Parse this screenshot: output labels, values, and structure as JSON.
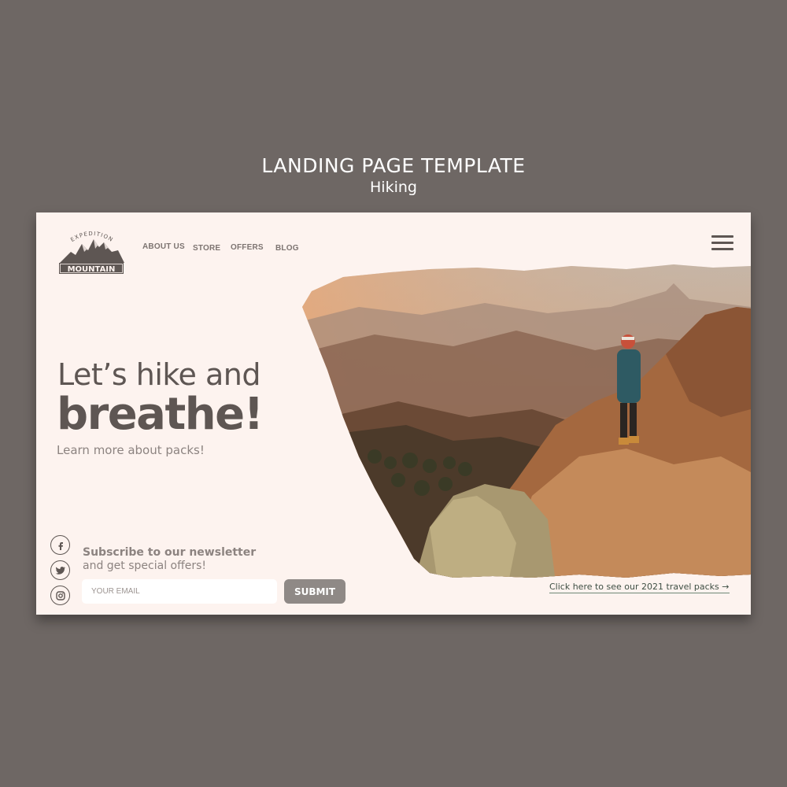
{
  "header": {
    "title": "LANDING PAGE TEMPLATE",
    "subtitle": "Hiking"
  },
  "logo": {
    "top_text": "EXPEDITION",
    "name": "MOUNTAIN"
  },
  "nav": {
    "items": [
      {
        "label": "ABOUT US"
      },
      {
        "label": "STORE"
      },
      {
        "label": "OFFERS"
      },
      {
        "label": "BLOG"
      }
    ]
  },
  "hero": {
    "line1": "Let’s hike and",
    "line2": "breathe!",
    "cta": "Learn more about packs!"
  },
  "social": {
    "icons": [
      "facebook-icon",
      "twitter-icon",
      "instagram-icon"
    ]
  },
  "newsletter": {
    "line1": "Subscribe to our newsletter",
    "line2": "and get special offers!",
    "email_placeholder": "YOUR EMAIL",
    "submit_label": "SUBMIT"
  },
  "footer_link": {
    "label": "Click here to see our 2021 travel packs →"
  },
  "colors": {
    "background": "#6e6764",
    "card": "#fdf3ef",
    "text_dark": "#5e5653",
    "text_muted": "#8c8380",
    "button": "#8f8986"
  }
}
